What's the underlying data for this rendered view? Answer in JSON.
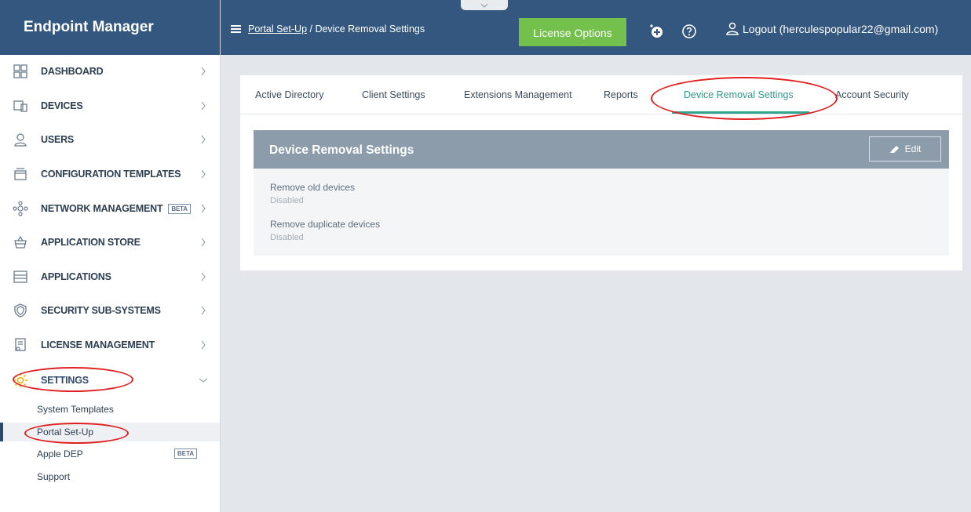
{
  "app": {
    "title": "Endpoint Manager"
  },
  "topbar": {
    "breadcrumb_link": "Portal Set-Up",
    "breadcrumb_sep": " / ",
    "breadcrumb_current": "Device Removal Settings",
    "license_label": "License Options",
    "logout_label": "Logout (herculespopular22@gmail.com)"
  },
  "sidebar": {
    "items": [
      {
        "label": "DASHBOARD",
        "icon": "dashboard-icon"
      },
      {
        "label": "DEVICES",
        "icon": "devices-icon"
      },
      {
        "label": "USERS",
        "icon": "users-icon"
      },
      {
        "label": "CONFIGURATION TEMPLATES",
        "icon": "templates-icon"
      },
      {
        "label": "NETWORK MANAGEMENT",
        "icon": "network-icon",
        "badge": "BETA"
      },
      {
        "label": "APPLICATION STORE",
        "icon": "store-icon"
      },
      {
        "label": "APPLICATIONS",
        "icon": "applications-icon"
      },
      {
        "label": "SECURITY SUB-SYSTEMS",
        "icon": "shield-icon"
      },
      {
        "label": "LICENSE MANAGEMENT",
        "icon": "license-icon"
      },
      {
        "label": "SETTINGS",
        "icon": "gear-icon"
      }
    ],
    "settings_sub": [
      {
        "label": "System Templates"
      },
      {
        "label": "Portal Set-Up",
        "active": true
      },
      {
        "label": "Apple DEP",
        "badge": "BETA"
      },
      {
        "label": "Support"
      }
    ]
  },
  "tabs": [
    {
      "label": "Active Directory"
    },
    {
      "label": "Client Settings"
    },
    {
      "label": "Extensions Management"
    },
    {
      "label": "Reports"
    },
    {
      "label": "Device Removal Settings",
      "active": true
    },
    {
      "label": "Account Security"
    }
  ],
  "panel": {
    "title": "Device Removal Settings",
    "edit_label": "Edit",
    "fields": [
      {
        "label": "Remove old devices",
        "value": "Disabled"
      },
      {
        "label": "Remove duplicate devices",
        "value": "Disabled"
      }
    ]
  },
  "colors": {
    "header": "#33577e",
    "license_button": "#74c04c",
    "active_tab": "#2f9a8a",
    "annotation": "#e02020"
  }
}
